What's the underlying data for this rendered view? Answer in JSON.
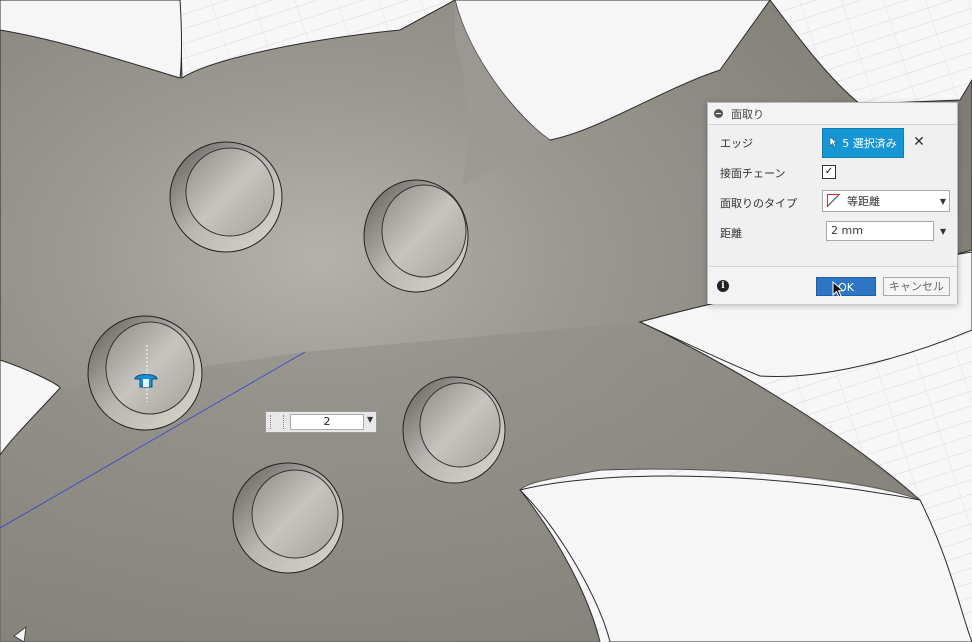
{
  "dialog": {
    "title": "面取り",
    "rows": {
      "edge_label": "エッジ",
      "edge_selection": "5 選択済み",
      "tangent_chain_label": "接面チェーン",
      "tangent_chain_checked": true,
      "type_label": "面取りのタイプ",
      "type_value": "等距離",
      "distance_label": "距離",
      "distance_value": "2 mm"
    },
    "ok_label": "OK",
    "cancel_label": "キャンセル"
  },
  "canvas_input": {
    "value": "2"
  },
  "icons": {
    "collapse": "collapse-minus-icon",
    "select": "selection-cursor-icon",
    "clear": "close-icon",
    "checkbox": "checkmark-icon",
    "chamfer_type": "equal-distance-chamfer-icon",
    "info": "info-icon",
    "manipulator": "distance-manipulator-arrow-icon",
    "mouse": "mouse-pointer-icon"
  },
  "colors": {
    "selection_blue": "#1696d2",
    "ok_blue": "#2e75c4",
    "model_gray": "#8a8780",
    "background": "#f2f2f2"
  }
}
